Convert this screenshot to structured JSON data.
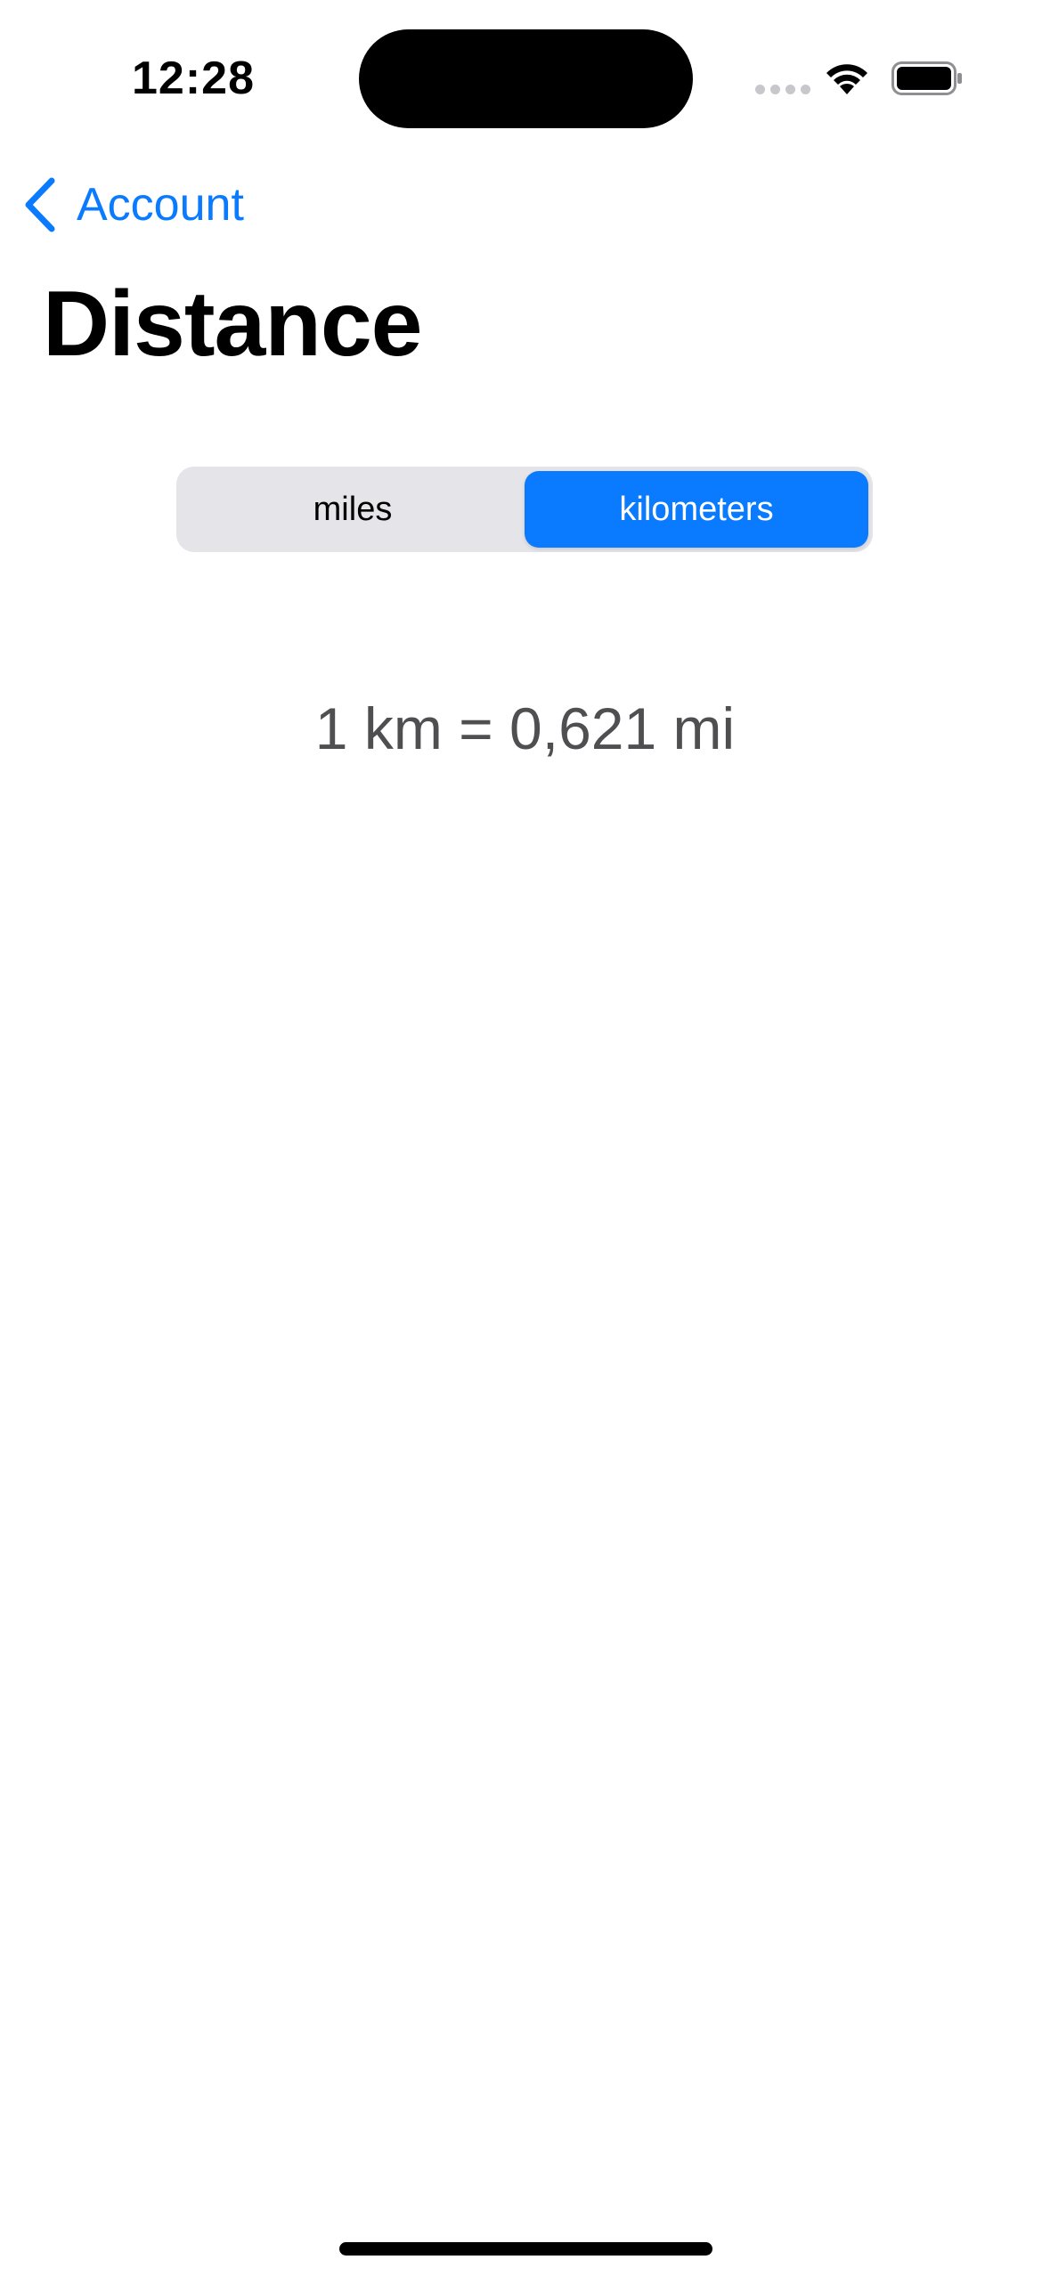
{
  "status_bar": {
    "time": "12:28"
  },
  "nav": {
    "back_label": "Account",
    "back_icon": "chevron-left-icon"
  },
  "page": {
    "title": "Distance"
  },
  "segmented_control": {
    "options": [
      "miles",
      "kilometers"
    ],
    "selected": "kilometers"
  },
  "conversion_text": "1 km = 0,621 mi",
  "colors": {
    "accent": "#0a7aff",
    "segment_background": "#e4e4e9",
    "secondary_text": "#4f4f52"
  }
}
